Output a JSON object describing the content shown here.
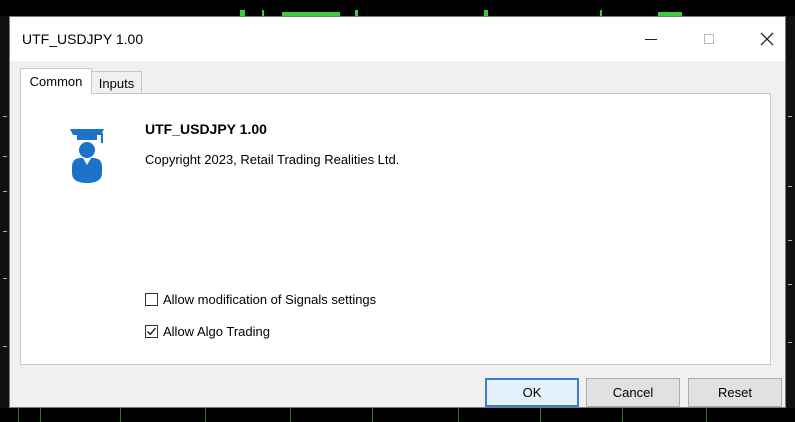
{
  "window": {
    "title": "UTF_USDJPY 1.00",
    "controls": {
      "minimize": "minimize-icon",
      "maximize": "maximize-icon",
      "close": "close-icon"
    }
  },
  "tabs": [
    {
      "label": "Common",
      "active": true
    },
    {
      "label": "Inputs",
      "active": false
    }
  ],
  "common": {
    "icon": "expert-advisor-graduate-icon",
    "product_name": "UTF_USDJPY 1.00",
    "copyright": "Copyright 2023, Retail Trading Realities Ltd.",
    "options": [
      {
        "label": "Allow modification of Signals settings",
        "checked": false
      },
      {
        "label": "Allow Algo Trading",
        "checked": true
      }
    ]
  },
  "buttons": {
    "ok": "OK",
    "cancel": "Cancel",
    "reset": "Reset"
  },
  "colors": {
    "icon_blue": "#1a73c8",
    "accent": "#3b7fd1"
  }
}
